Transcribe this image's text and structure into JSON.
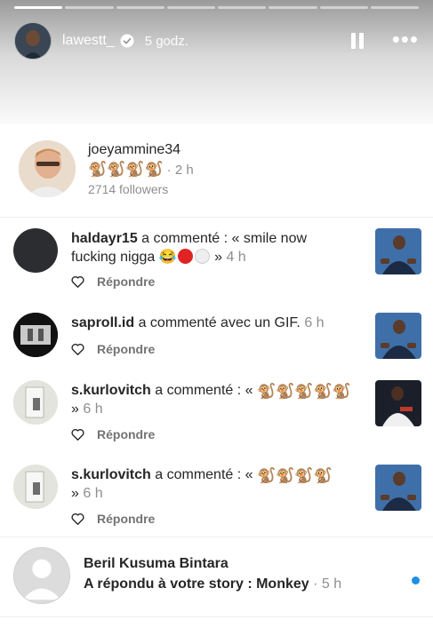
{
  "story": {
    "username": "lawestt_",
    "time": "5 godz.",
    "progress_segments": 8,
    "active_segment": 0,
    "pause_icon": "pause-icon",
    "more_icon": "more-icon"
  },
  "profile_card": {
    "name": "joeyammine34",
    "monkeys": "🐒🐒🐒🐒",
    "time": "· 2 h",
    "followers": "2714 followers"
  },
  "comments": [
    {
      "user": "haldayr15",
      "action": " a commenté : « smile now fucking nigga ",
      "emoji": "😂",
      "tail": " »",
      "time": " 4 h",
      "reply_label": "Répondre"
    },
    {
      "user": "saproll.id",
      "action": " a commenté avec un GIF.",
      "time": " 6 h",
      "reply_label": "Répondre"
    },
    {
      "user": "s.kurlovitch",
      "action": " a commenté : « ",
      "monkeys": "🐒🐒🐒🐒🐒",
      "tail": " »",
      "time": " 6 h",
      "reply_label": "Répondre"
    },
    {
      "user": "s.kurlovitch",
      "action": " a commenté : « ",
      "monkeys": "🐒🐒🐒🐒",
      "tail": " »",
      "time": " 6 h",
      "reply_label": "Répondre"
    }
  ],
  "story_reply": {
    "name": "Beril Kusuma Bintara",
    "text": "A répondu à votre story : Monkey",
    "time": " · 5 h"
  },
  "colors": {
    "text": "#262626",
    "secondary": "#8e8e8e",
    "unread_dot": "#1f8fe6",
    "verified": "#ffffff"
  }
}
